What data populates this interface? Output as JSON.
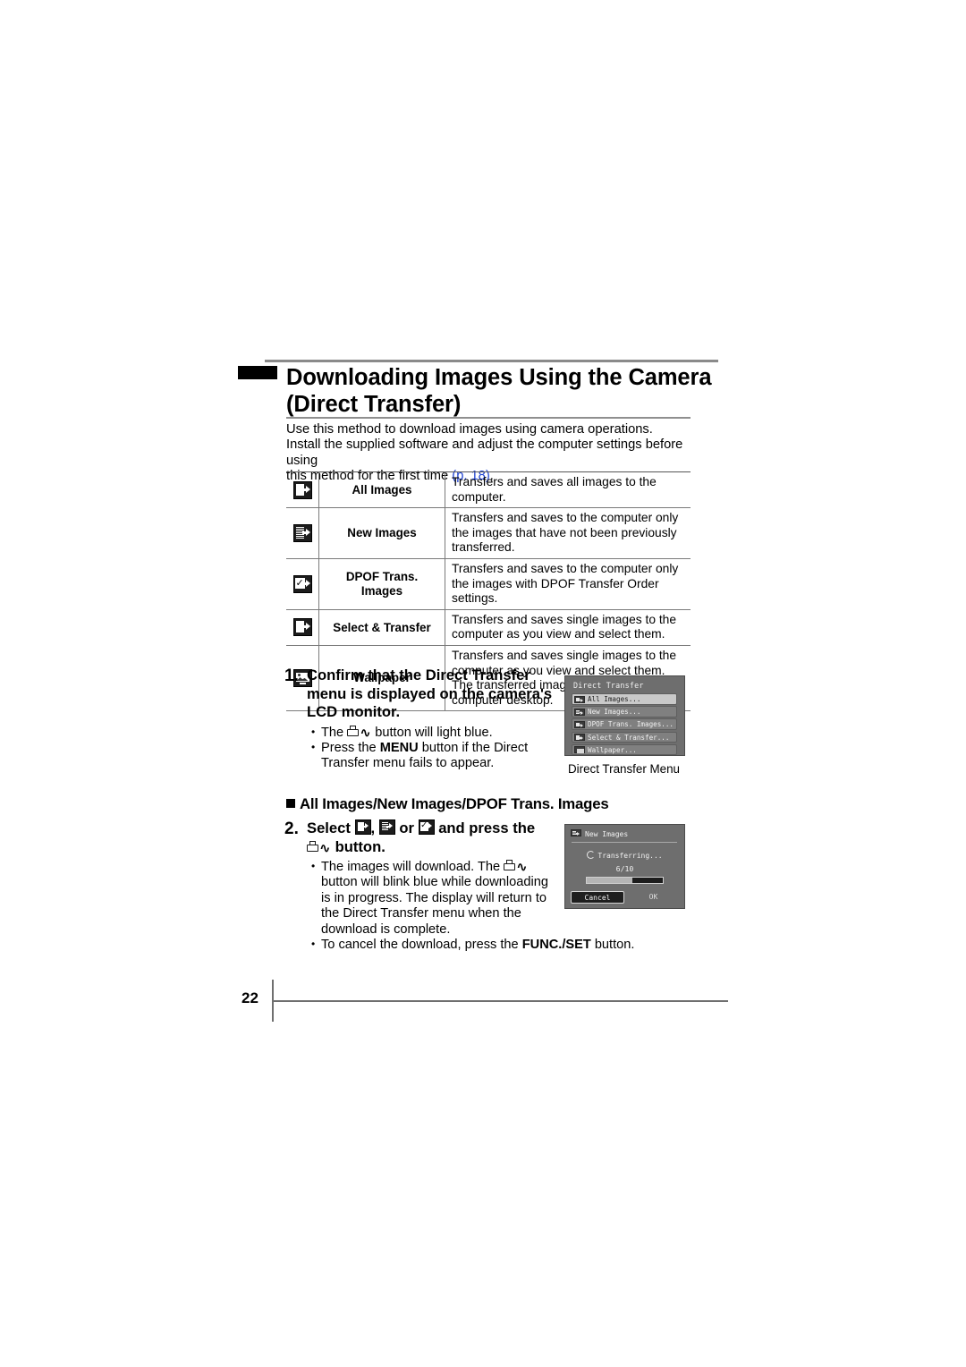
{
  "document": {
    "page_number": "22",
    "title": "Downloading Images Using the Camera (Direct Transfer)",
    "title_line1": "Downloading Images Using the Camera",
    "title_line2": "(Direct Transfer)",
    "intro_line1": "Use this method to download images using camera operations.",
    "intro_line2": "Install the supplied software and adjust the computer settings before using",
    "intro_line3_pre": "this method for the first time ",
    "intro_pageref": "(p. 18)",
    "intro_line3_post": ".",
    "pageref_color": "#1a3fd0"
  },
  "feature_table": {
    "rows": [
      {
        "icon": "transfer-all-icon",
        "name": "All Images",
        "description": "Transfers and saves all images to the computer."
      },
      {
        "icon": "transfer-new-icon",
        "name": "New Images",
        "description": "Transfers and saves to the computer only the images that have not been previously transferred."
      },
      {
        "icon": "transfer-dpof-icon",
        "name": "DPOF Trans. Images",
        "name_line1": "DPOF Trans.",
        "name_line2": "Images",
        "description": "Transfers and saves to the computer only the images with DPOF Transfer Order settings."
      },
      {
        "icon": "transfer-select-icon",
        "name": "Select & Transfer",
        "description": "Transfers and saves single images to the computer as you view and select them."
      },
      {
        "icon": "wallpaper-icon",
        "name": "Wallpaper",
        "description": "Transfers and saves single images to the computer as you view and select them. The transferred images display on the computer desktop."
      }
    ]
  },
  "steps": [
    {
      "number": "1.",
      "heading": "Confirm that the Direct Transfer menu is displayed on the camera's LCD monitor.",
      "bullets": [
        {
          "pre": "The ",
          "glyph": "print-share-button-icon",
          "post": " button will light blue."
        },
        {
          "pre": "Press the ",
          "bold": "MENU",
          "post": " button if the Direct Transfer menu fails to appear."
        }
      ]
    },
    {
      "number": "2.",
      "heading_pre": "Select ",
      "heading_mid": ", ",
      "heading_or": " or ",
      "heading_post": " and press the",
      "heading_line2_post": " button.",
      "bullets": [
        {
          "pre": "The images will download. The ",
          "glyph": "print-share-button-icon",
          "post": " button will blink blue while downloading is in progress. The display will return to the Direct Transfer menu when the download is complete."
        },
        {
          "pre": "To cancel the download, press the ",
          "bold": "FUNC./SET",
          "post": " button."
        }
      ]
    }
  ],
  "subheading": "All Images/New Images/DPOF Trans. Images",
  "lcd_menu": {
    "title": "Direct Transfer",
    "caption": "Direct Transfer Menu",
    "items": [
      {
        "label": "All Images...",
        "selected": true,
        "icon": "transfer-all-icon"
      },
      {
        "label": "New Images...",
        "selected": false,
        "icon": "transfer-new-icon"
      },
      {
        "label": "DPOF Trans. Images...",
        "selected": false,
        "icon": "transfer-dpof-icon"
      },
      {
        "label": "Select & Transfer...",
        "selected": false,
        "icon": "transfer-select-icon"
      },
      {
        "label": "Wallpaper...",
        "selected": false,
        "icon": "wallpaper-icon"
      }
    ]
  },
  "lcd_transfer": {
    "title": "New Images",
    "status": "Transferring...",
    "count": "6/10",
    "progress_percent": 60,
    "cancel_label": "Cancel",
    "ok_label": "OK"
  }
}
